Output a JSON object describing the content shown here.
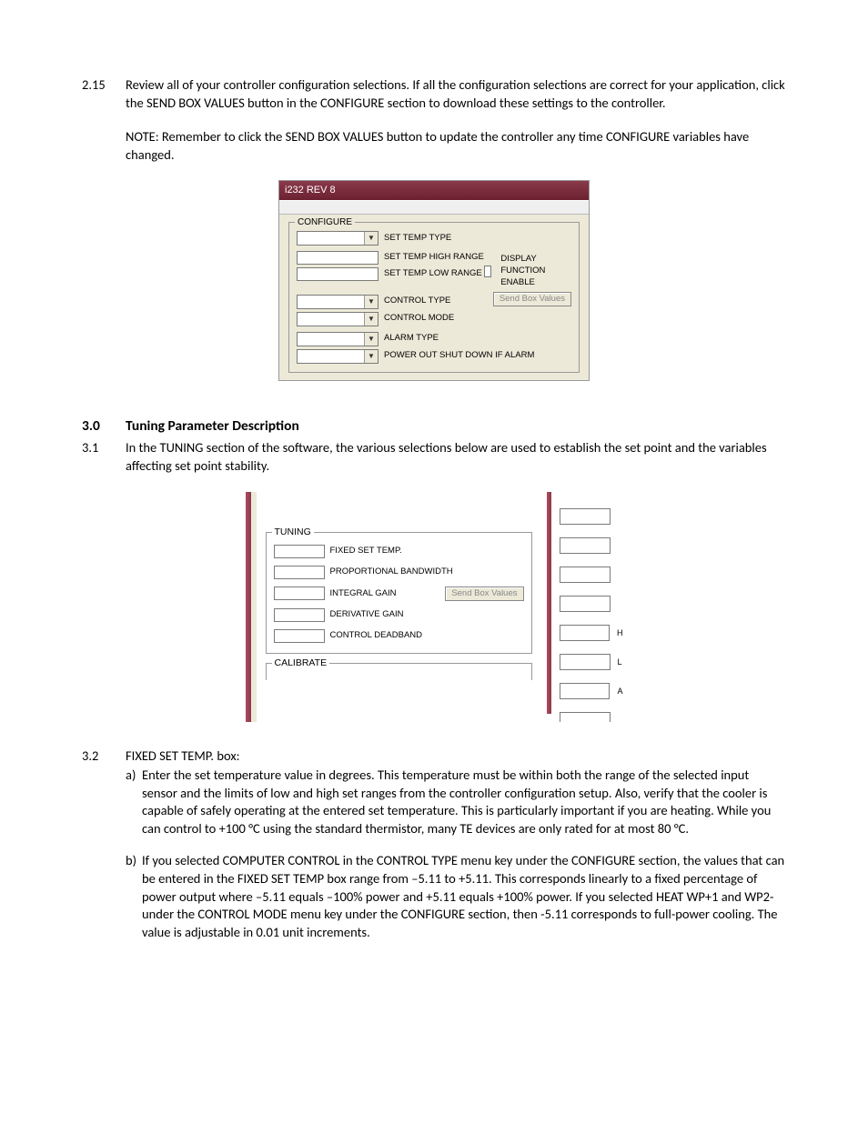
{
  "section1": {
    "num": "2.15",
    "text": "Review all of your controller configuration selections.  If all the configuration selections are correct for your application, click the SEND BOX VALUES button in the CONFIGURE section to download these settings to the controller.",
    "note": "NOTE: Remember to click the SEND BOX VALUES button to update the controller any time CONFIGURE variables have changed."
  },
  "shot1": {
    "title": "i232 REV 8",
    "legend": "CONFIGURE",
    "labels": {
      "set_temp_type": "SET TEMP TYPE",
      "set_temp_high": "SET TEMP HIGH RANGE",
      "set_temp_low": "SET TEMP LOW RANGE",
      "control_type": "CONTROL TYPE",
      "control_mode": "CONTROL MODE",
      "alarm_type": "ALARM TYPE",
      "power_out": "POWER OUT SHUT DOWN IF ALARM",
      "display_fn": "DISPLAY FUNCTION ENABLE",
      "send": "Send Box Values"
    }
  },
  "heading": {
    "num": "3.0",
    "text": "Tuning Parameter Description"
  },
  "section2": {
    "num": "3.1",
    "text": "In the TUNING section of the software, the various selections below are used to establish the set point and the variables affecting set point stability."
  },
  "shot2": {
    "legend": "TUNING",
    "labels": {
      "fixed": "FIXED SET TEMP.",
      "prop": "PROPORTIONAL BANDWIDTH",
      "integral": "INTEGRAL GAIN",
      "deriv": "DERIVATIVE GAIN",
      "dead": "CONTROL DEADBAND",
      "send": "Send Box Values",
      "calibrate": "CALIBRATE"
    },
    "right": {
      "h": "H",
      "l": "L",
      "a": "A"
    }
  },
  "section3": {
    "num": "3.2",
    "lead": "FIXED SET TEMP. box:",
    "a": "Enter the set temperature value in degrees.  This temperature must be within both the range of the selected input sensor and the limits of low and high set ranges from the controller configuration setup.  Also, verify that the cooler is capable of safely operating at the entered set temperature.  This is particularly important if you are heating.  While you can control to +100 °C using the standard thermistor, many TE devices are only rated for at most 80 °C.",
    "b": "If you selected COMPUTER CONTROL in the CONTROL TYPE menu key under the CONFIGURE section, the values that can be entered in the FIXED SET TEMP box range from        –5.11 to +5.11.  This corresponds linearly to a fixed percentage of power output where –5.11 equals –100% power and +5.11 equals +100% power. If you selected HEAT WP+1 and WP2- under the CONTROL MODE menu key under the CONFIGURE section, then -5.11 corresponds to full-power cooling.  The value is adjustable in 0.01 unit increments."
  }
}
